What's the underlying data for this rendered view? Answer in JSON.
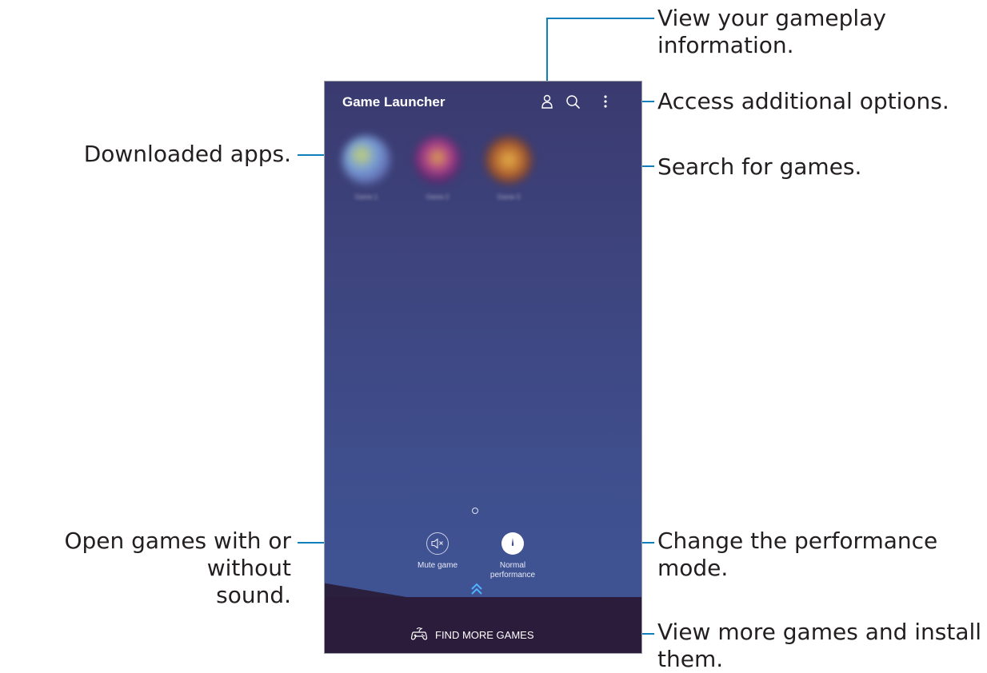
{
  "app": {
    "title": "Game Launcher"
  },
  "apps": [
    {
      "name": "Game 1",
      "thumb_color": "#6e82b8"
    },
    {
      "name": "Game 2",
      "thumb_color": "#8a5aa0"
    },
    {
      "name": "Game 3",
      "thumb_color": "#b06a3a"
    }
  ],
  "controls": {
    "mute_label": "Mute game",
    "performance_label_line1": "Normal",
    "performance_label_line2": "performance"
  },
  "footer": {
    "find_more_label": "FIND MORE GAMES"
  },
  "callouts": {
    "gameplay_info_line1": "View your gameplay",
    "gameplay_info_line2": "information.",
    "additional_options": "Access additional options.",
    "downloaded_apps": "Downloaded apps.",
    "search_games": "Search for games.",
    "open_games_line1": "Open games with or without",
    "open_games_line2": "sound.",
    "performance_mode": "Change the performance mode.",
    "view_more_line1": "View more games and install",
    "view_more_line2": "them."
  },
  "icons": {
    "profile": "person-outline-icon",
    "search": "magnifier-icon",
    "more": "vertical-dots-icon",
    "mute": "speaker-muted-icon",
    "performance": "gauge-icon",
    "expand": "double-chevron-up-icon",
    "gamepad": "gamepad-icon"
  },
  "colors": {
    "leader_line": "#0e7fb8",
    "callout_text": "#231f20",
    "expand_chevron": "#4fb3ff"
  }
}
